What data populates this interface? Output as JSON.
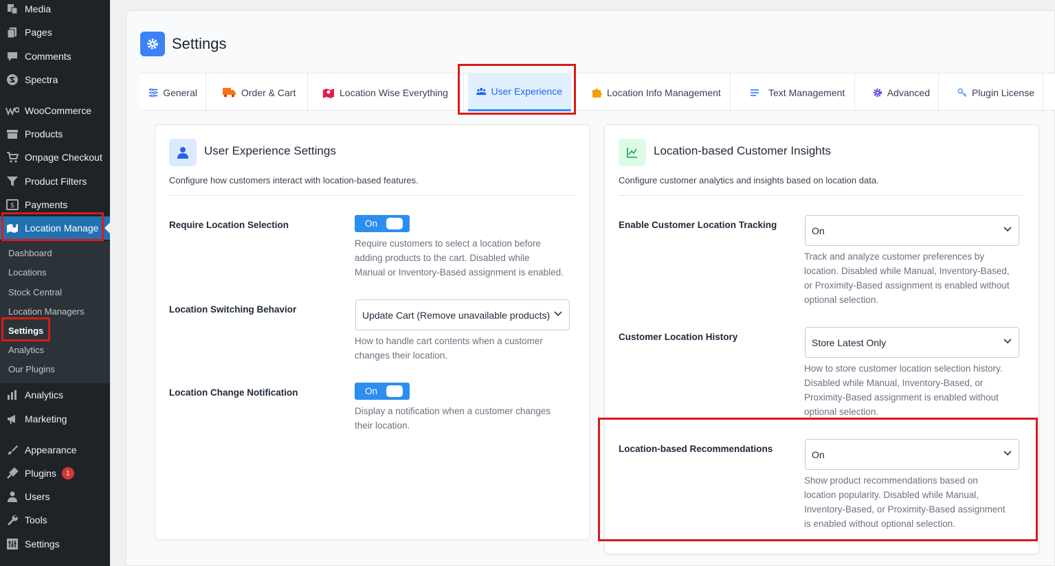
{
  "sidebar": {
    "items": [
      {
        "label": "Media",
        "icon": "media-icon"
      },
      {
        "label": "Pages",
        "icon": "pages-icon"
      },
      {
        "label": "Comments",
        "icon": "comments-icon"
      },
      {
        "label": "Spectra",
        "icon": "spectra-icon"
      },
      {
        "label": "WooCommerce",
        "icon": "woocommerce-icon"
      },
      {
        "label": "Products",
        "icon": "products-icon"
      },
      {
        "label": "Onpage Checkout",
        "icon": "cart-icon"
      },
      {
        "label": "Product Filters",
        "icon": "filter-icon"
      },
      {
        "label": "Payments",
        "icon": "payments-icon"
      },
      {
        "label": "Location Manage",
        "icon": "map-icon"
      },
      {
        "label": "Analytics",
        "icon": "analytics-icon"
      },
      {
        "label": "Marketing",
        "icon": "megaphone-icon"
      },
      {
        "label": "Appearance",
        "icon": "brush-icon"
      },
      {
        "label": "Plugins",
        "icon": "plugin-icon",
        "badge": "1"
      },
      {
        "label": "Users",
        "icon": "users-icon"
      },
      {
        "label": "Tools",
        "icon": "wrench-icon"
      },
      {
        "label": "Settings",
        "icon": "settings-icon"
      }
    ],
    "submenu": [
      "Dashboard",
      "Locations",
      "Stock Central",
      "Location Managers",
      "Settings",
      "Analytics",
      "Our Plugins"
    ]
  },
  "page": {
    "title": "Settings"
  },
  "tabs": [
    "General",
    "Order & Cart",
    "Location Wise Everything",
    "User Experience",
    "Location Info Management",
    "Text Management",
    "Advanced",
    "Plugin License"
  ],
  "ux_card": {
    "title": "User Experience Settings",
    "description": "Configure how customers interact with location-based features.",
    "require_label": "Require Location Selection",
    "require_toggle": "On",
    "require_help": [
      "Require customers to select a location before",
      "adding products to the cart. Disabled while",
      "Manual or Inventory-Based assignment is enabled."
    ],
    "switching_label": "Location Switching Behavior",
    "switching_value": "Update Cart (Remove unavailable products)",
    "switching_help": [
      "How to handle cart contents when a customer",
      "changes their location."
    ],
    "notify_label": "Location Change Notification",
    "notify_toggle": "On",
    "notify_help": [
      "Display a notification when a customer changes",
      "their location."
    ]
  },
  "insights_card": {
    "title": "Location-based Customer Insights",
    "description": "Configure customer analytics and insights based on location data.",
    "tracking_label": "Enable Customer Location Tracking",
    "tracking_value": "On",
    "tracking_help": [
      "Track and analyze customer preferences by",
      "location. Disabled while Manual, Inventory-Based,",
      "or Proximity-Based assignment is enabled without",
      "optional selection."
    ],
    "history_label": "Customer Location History",
    "history_value": "Store Latest Only",
    "history_help": [
      "How to store customer location selection history.",
      "Disabled while Manual, Inventory-Based, or",
      "Proximity-Based assignment is enabled without",
      "optional selection."
    ],
    "recommend_label": "Location-based Recommendations",
    "recommend_value": "On",
    "recommend_help": [
      "Show product recommendations based on",
      "location popularity. Disabled while Manual,",
      "Inventory-Based, or Proximity-Based assignment",
      "is enabled without optional selection."
    ]
  },
  "colors": {
    "accent": "#2271b1",
    "primary_blue": "#3b82f6",
    "highlight_red": "#d91a1a",
    "sidebar_bg": "#1d2327"
  }
}
